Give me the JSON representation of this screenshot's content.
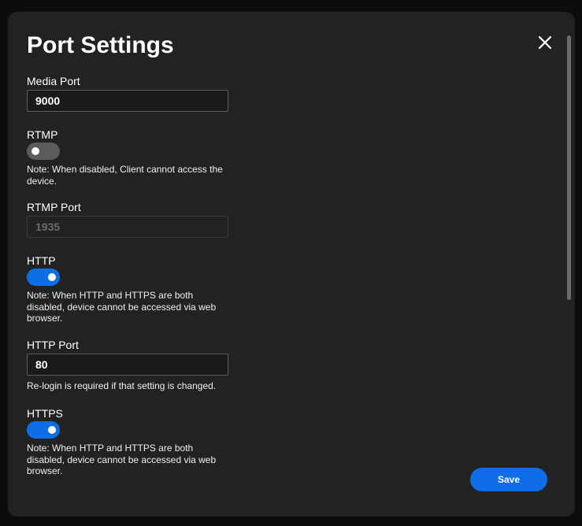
{
  "dialog": {
    "title": "Port Settings",
    "close_icon": "close-icon",
    "save_label": "Save"
  },
  "fields": {
    "media_port": {
      "label": "Media Port",
      "value": "9000"
    },
    "rtmp": {
      "label": "RTMP",
      "enabled": false,
      "note": "Note: When disabled, Client cannot access the device."
    },
    "rtmp_port": {
      "label": "RTMP Port",
      "value": "1935",
      "disabled": true
    },
    "http": {
      "label": "HTTP",
      "enabled": true,
      "note": "Note: When HTTP and HTTPS are both disabled, device cannot be accessed via web browser."
    },
    "http_port": {
      "label": "HTTP Port",
      "value": "80",
      "hint": "Re-login is required if that setting is changed."
    },
    "https": {
      "label": "HTTPS",
      "enabled": true,
      "note": "Note: When HTTP and HTTPS are both disabled, device cannot be accessed via web browser."
    }
  },
  "colors": {
    "accent": "#0f6de6",
    "dialog_background": "#222222",
    "toggle_off": "#5b5b5b"
  }
}
